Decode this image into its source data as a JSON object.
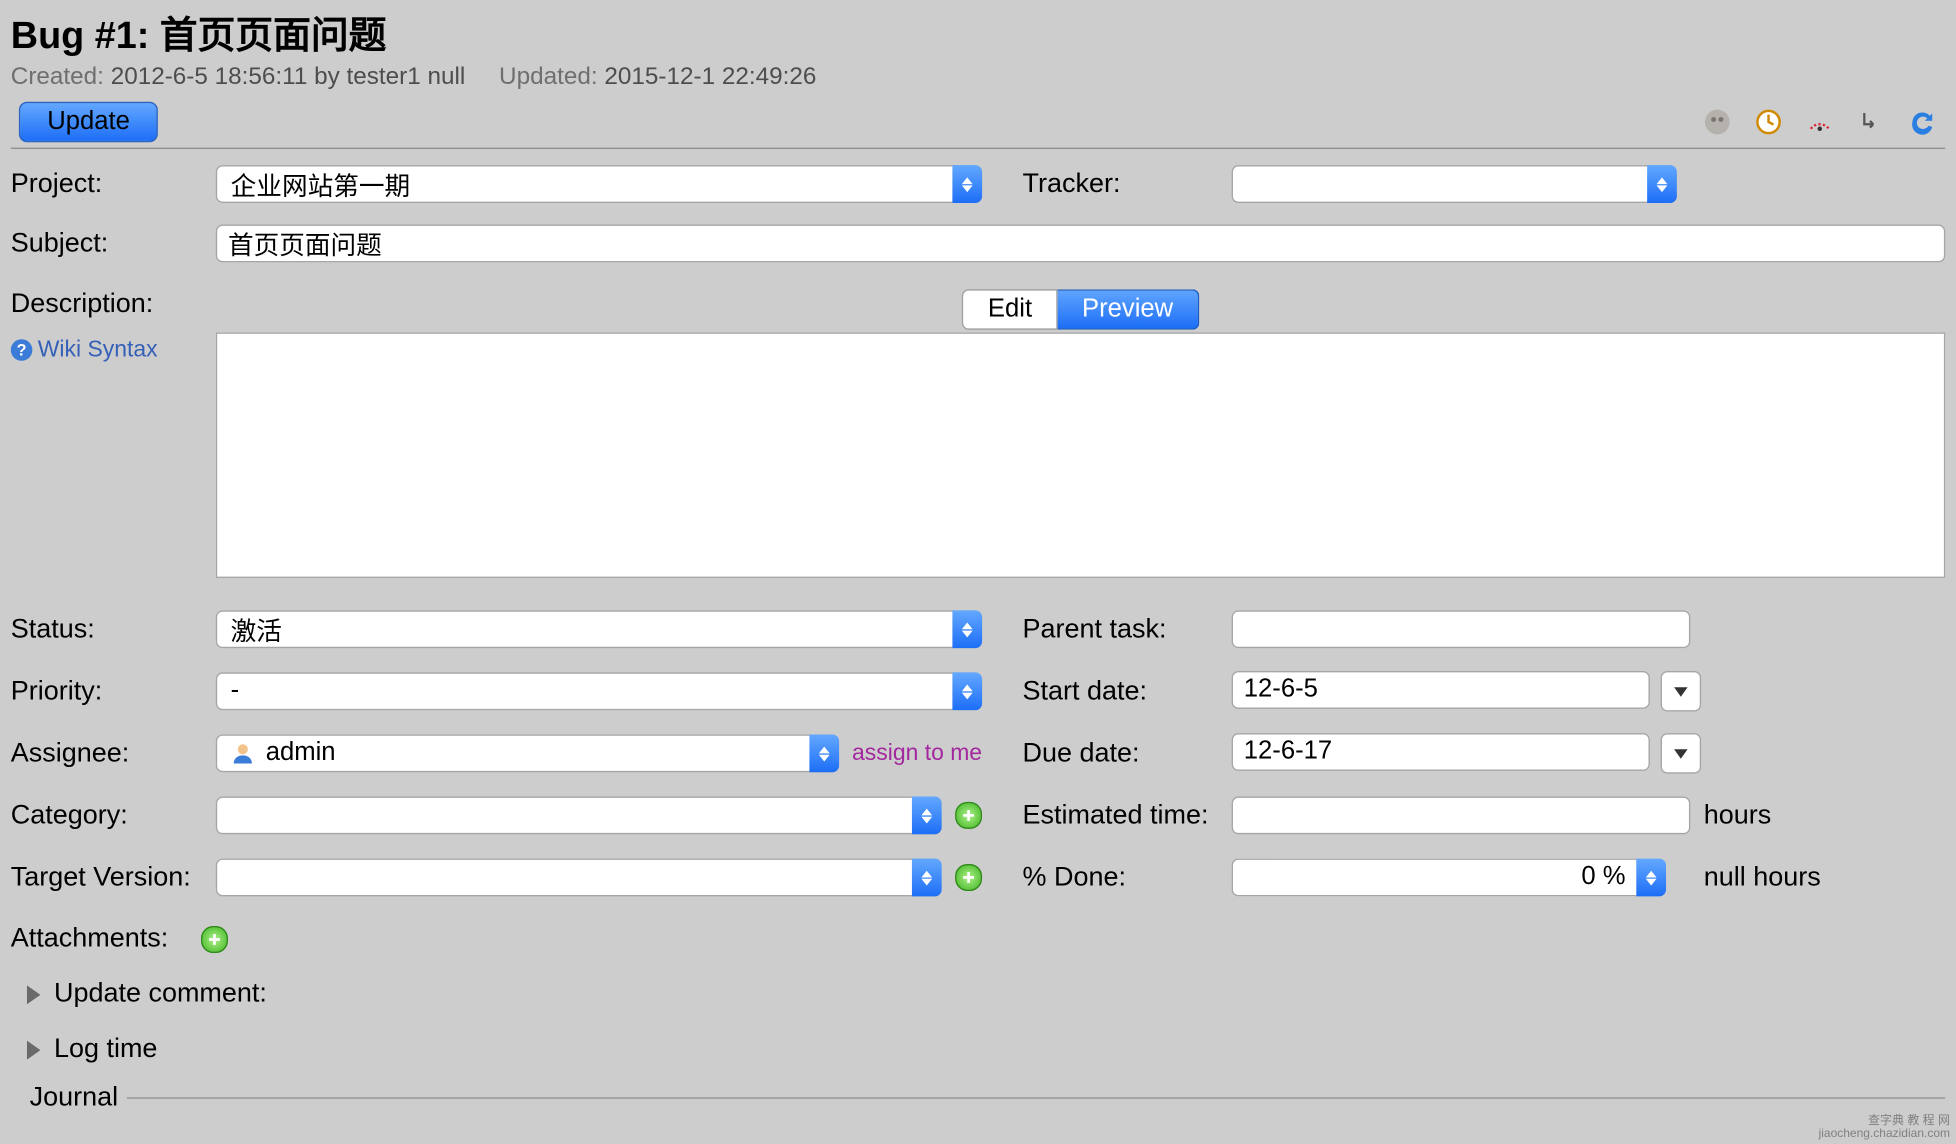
{
  "header": {
    "title": "Bug #1: 首页页面问题",
    "created_label": "Created:",
    "created_value": "2012-6-5 18:56:11 by tester1 null",
    "updated_label": "Updated:",
    "updated_value": "2015-12-1 22:49:26"
  },
  "toolbar": {
    "update_label": "Update"
  },
  "labels": {
    "project": "Project:",
    "tracker": "Tracker:",
    "subject": "Subject:",
    "description": "Description:",
    "wiki_syntax": "Wiki Syntax",
    "edit_tab": "Edit",
    "preview_tab": "Preview",
    "status": "Status:",
    "priority": "Priority:",
    "assignee": "Assignee:",
    "category": "Category:",
    "target_version": "Target Version:",
    "parent_task": "Parent task:",
    "start_date": "Start date:",
    "due_date": "Due date:",
    "estimated_time": "Estimated time:",
    "hours": "hours",
    "percent_done": "% Done:",
    "null_hours": "null hours",
    "attachments": "Attachments:",
    "update_comment": "Update comment:",
    "log_time": "Log time",
    "journal": "Journal",
    "assign_to_me": "assign to me"
  },
  "values": {
    "project": "企业网站第一期",
    "tracker": "",
    "subject": "首页页面问题",
    "status": "激活",
    "priority": "-",
    "assignee": "admin",
    "category": "",
    "target_version": "",
    "parent_task": "",
    "start_date": "12-6-5",
    "due_date": "12-6-17",
    "estimated_time": "",
    "percent_done": "0 %"
  },
  "watermark": {
    "l1": "查字典  教 程 网",
    "l2": "jiaocheng.chazidian.com"
  }
}
